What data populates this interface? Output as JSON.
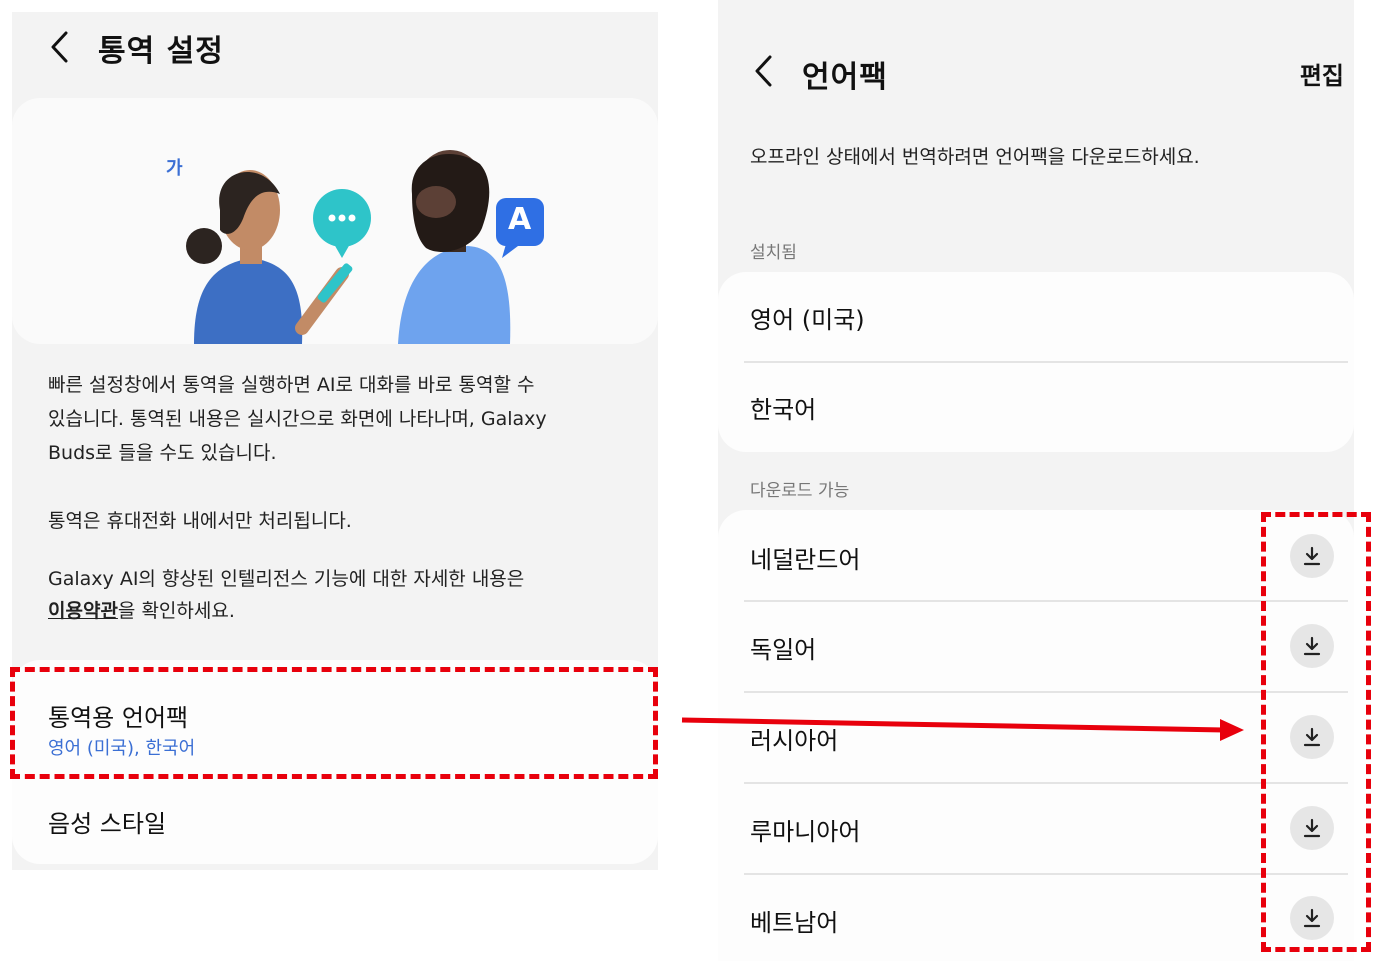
{
  "left_screen": {
    "title": "통역 설정",
    "illustration": {
      "left_bubble_char": "가",
      "right_bubble_char": "A"
    },
    "description": {
      "line1": "빠른 설정창에서 통역을 실행하면 AI로 대화를 바로 통역할 수",
      "line2": "있습니다. 통역된 내용은 실시간으로 화면에 나타나며, Galaxy",
      "line3": "Buds로 들을 수도 있습니다.",
      "line4": "통역은 휴대전화 내에서만 처리됩니다.",
      "line5": "Galaxy AI의 향상된 인텔리전스 기능에 대한 자세한 내용은",
      "terms_link": "이용약관",
      "line6_suffix": "을 확인하세요."
    },
    "language_pack_item": {
      "title": "통역용 언어팩",
      "subtitle": "영어 (미국), 한국어"
    },
    "voice_style_item": {
      "title": "음성 스타일"
    }
  },
  "right_screen": {
    "title": "언어팩",
    "edit_label": "편집",
    "description": "오프라인 상태에서 번역하려면 언어팩을 다운로드하세요.",
    "installed_header": "설치됨",
    "installed": [
      "영어 (미국)",
      "한국어"
    ],
    "available_header": "다운로드 가능",
    "available": [
      "네덜란드어",
      "독일어",
      "러시아어",
      "루마니아어",
      "베트남어"
    ]
  },
  "colors": {
    "highlight_red": "#e8000c",
    "link_blue": "#3b6fd4",
    "panel_bg": "#f3f3f3"
  }
}
